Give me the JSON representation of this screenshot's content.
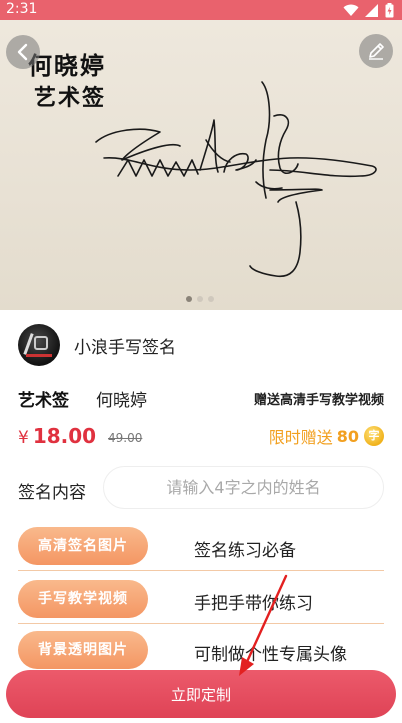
{
  "status_bar": {
    "time": "2:31",
    "icons": [
      "wifi-icon",
      "signal-icon",
      "battery-icon"
    ]
  },
  "hero": {
    "image_text_name": "何晓婷",
    "image_text_style": "艺术签",
    "carousel_pages": 3,
    "carousel_active": 1,
    "back_icon": "chevron-left-icon",
    "edit_icon": "pen-icon"
  },
  "shop": {
    "name": "小浪手写签名"
  },
  "product": {
    "style": "艺术签",
    "name": "何晓婷",
    "bonus": "赠送高清手写教学视频"
  },
  "pricing": {
    "currency": "¥",
    "price": "18.00",
    "original_price": "49.00",
    "promo_text": "限时赠送",
    "promo_amount": "80",
    "promo_unit": "字"
  },
  "signature_field": {
    "label": "签名内容",
    "placeholder": "请输入4字之内的姓名",
    "value": ""
  },
  "features": [
    {
      "tag": "高清签名图片",
      "desc": "签名练习必备"
    },
    {
      "tag": "手写教学视频",
      "desc": "手把手带你练习"
    },
    {
      "tag": "背景透明图片",
      "desc": "可制做个性专属头像"
    }
  ],
  "cta": {
    "label": "立即定制"
  },
  "colors": {
    "primary": "#df4356",
    "status_bar": "#e9626d",
    "price": "#e0313f",
    "promo": "#f2a020",
    "feature_pill": "#f49663",
    "annotation_arrow": "#e32020"
  }
}
